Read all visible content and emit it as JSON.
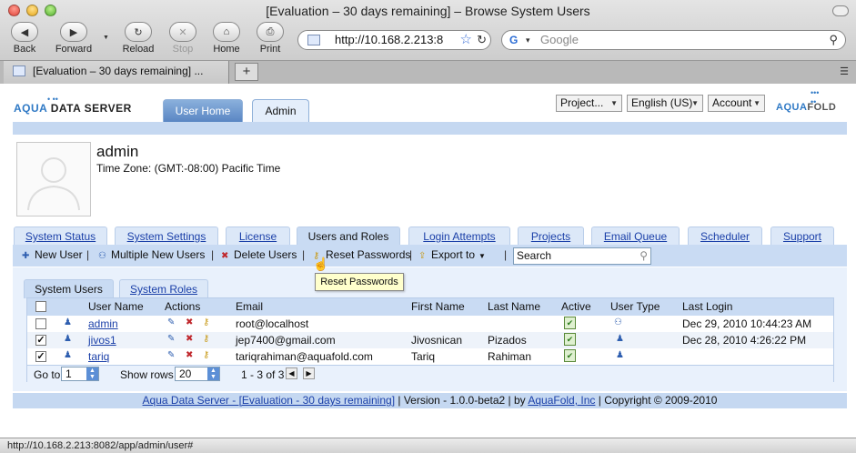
{
  "browser": {
    "window_title": "[Evaluation – 30 days remaining] – Browse System Users",
    "nav": {
      "back": "Back",
      "forward": "Forward",
      "reload": "Reload",
      "stop": "Stop",
      "home": "Home",
      "print": "Print"
    },
    "url": "http://10.168.2.213:8",
    "search_placeholder": "Google",
    "tab_title": "[Evaluation – 30 days remaining] ...",
    "new_tab": "+",
    "status_url": "http://10.168.2.213:8082/app/admin/user#"
  },
  "header": {
    "logo_left_aqua": "AQUA",
    "logo_left_rest": " DATA SERVER",
    "tabs": [
      "User Home",
      "Admin"
    ],
    "project_select": "Project...",
    "language_select": "English (US)",
    "account_select": "Account",
    "logo_right_aqua": "AQUA",
    "logo_right_rest": "FOLD"
  },
  "profile": {
    "name": "admin",
    "timezone": "Time Zone: (GMT:-08:00) Pacific Time"
  },
  "main_tabs": [
    "System Status",
    "System Settings",
    "License",
    "Users and Roles",
    "Login Attempts",
    "Projects",
    "Email Queue",
    "Scheduler",
    "Support"
  ],
  "toolbar": {
    "new_user": "New User",
    "multiple_new_users": "Multiple New Users",
    "delete_users": "Delete Users",
    "reset_passwords": "Reset Passwords",
    "export_to": "Export to",
    "search_value": "Search",
    "tooltip": "Reset Passwords"
  },
  "sub_tabs": [
    "System Users",
    "System Roles"
  ],
  "table": {
    "columns": [
      "User Name",
      "Actions",
      "Email",
      "First Name",
      "Last Name",
      "Active",
      "User Type",
      "Last Login"
    ],
    "rows": [
      {
        "checked": false,
        "user": "admin",
        "email": "root@localhost",
        "first": "",
        "last": "",
        "last_login": "Dec 29, 2010 10:44:23 AM"
      },
      {
        "checked": true,
        "user": "jivos1",
        "email": "jep7400@gmail.com",
        "first": "Jivosnican",
        "last": "Pizados",
        "last_login": "Dec 28, 2010 4:26:22 PM"
      },
      {
        "checked": true,
        "user": "tariq",
        "email": "tariqrahiman@aquafold.com",
        "first": "Tariq",
        "last": "Rahiman",
        "last_login": ""
      }
    ]
  },
  "pager": {
    "goto_label": "Go to",
    "goto_value": "1",
    "show_rows_label": "Show rows",
    "show_rows_value": "20",
    "range": "1 - 3 of 3"
  },
  "footer": {
    "link1": "Aqua Data Server - [Evaluation - 30 days remaining]",
    "sep1": " | Version - 1.0.0-beta2 | by ",
    "link2": "AquaFold, Inc",
    "sep2": " | Copyright © 2009-2010"
  }
}
